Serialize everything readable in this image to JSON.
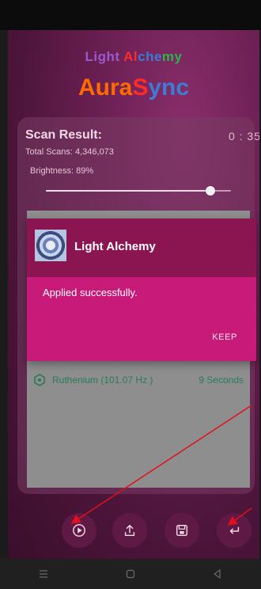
{
  "brand": {
    "top": "Light Alchemy",
    "main": "AuraSync"
  },
  "scan": {
    "title": "Scan Result:",
    "timer": "0 : 35",
    "total_label": "Total Scans:",
    "total_value": "4,346,073",
    "brightness_label": "Brightness:",
    "brightness_value": "89%",
    "brightness_fraction": 0.89
  },
  "list": {
    "item_name": "Ruthenium (101.07 Hz )",
    "item_duration": "9 Seconds"
  },
  "dialog": {
    "title": "Light Alchemy",
    "message": "Applied successfully.",
    "button": "KEEP"
  },
  "colors": {
    "accent": "#c81a78",
    "header": "#8a1550",
    "list_text": "#2a7a55"
  }
}
